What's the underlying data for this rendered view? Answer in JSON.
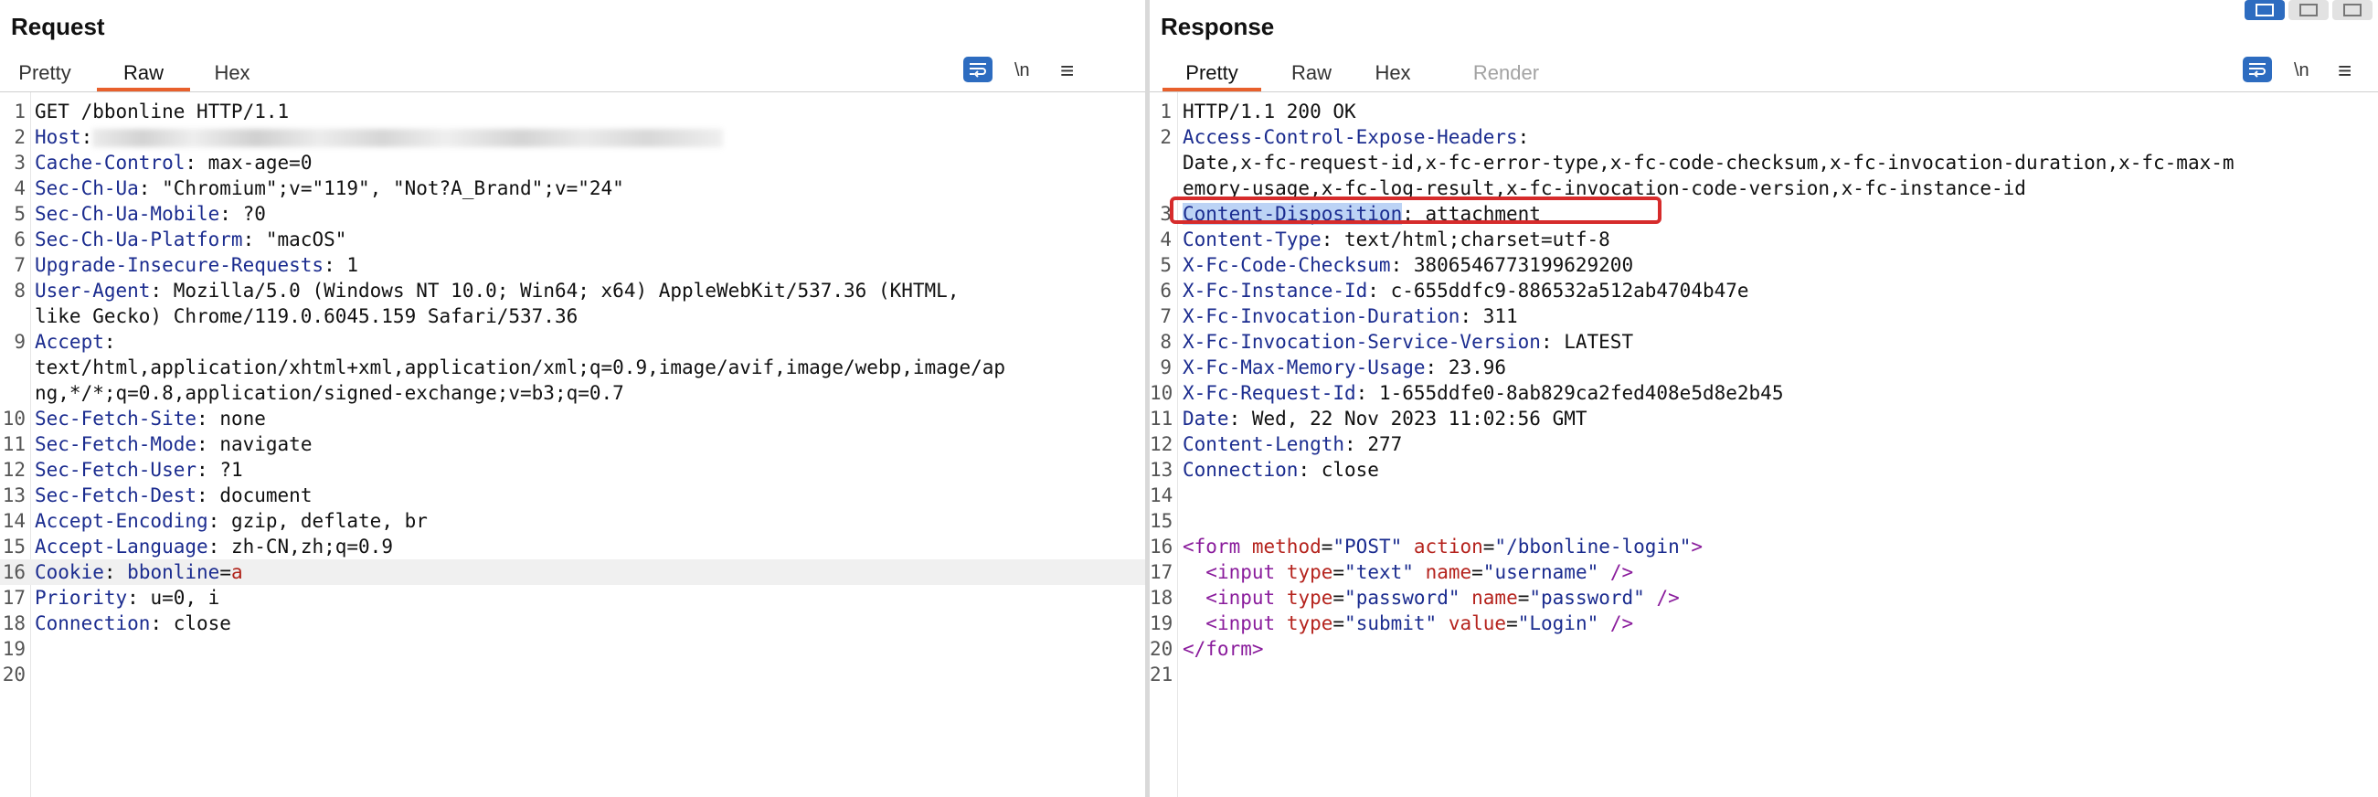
{
  "request": {
    "title": "Request",
    "tabs": [
      {
        "label": "Pretty",
        "state": "normal"
      },
      {
        "label": "Raw",
        "state": "active"
      },
      {
        "label": "Hex",
        "state": "normal"
      }
    ],
    "toolbar": {
      "wrap_icon": "wrap-lines-icon",
      "newline_label": "\\n",
      "menu_icon": "hamburger-menu-icon"
    },
    "lines": [
      {
        "n": "1",
        "plain": "GET /bbonline HTTP/1.1"
      },
      {
        "n": "2",
        "name": "Host",
        "value": "",
        "redacted": true
      },
      {
        "n": "3",
        "name": "Cache-Control",
        "value": " max-age=0"
      },
      {
        "n": "4",
        "name": "Sec-Ch-Ua",
        "value": " \"Chromium\";v=\"119\", \"Not?A_Brand\";v=\"24\""
      },
      {
        "n": "5",
        "name": "Sec-Ch-Ua-Mobile",
        "value": " ?0"
      },
      {
        "n": "6",
        "name": "Sec-Ch-Ua-Platform",
        "value": " \"macOS\""
      },
      {
        "n": "7",
        "name": "Upgrade-Insecure-Requests",
        "value": " 1"
      },
      {
        "n": "8",
        "name": "User-Agent",
        "value": " Mozilla/5.0 (Windows NT 10.0; Win64; x64) AppleWebKit/537.36 (KHTML,"
      },
      {
        "n": "",
        "plain": "like Gecko) Chrome/119.0.6045.159 Safari/537.36"
      },
      {
        "n": "9",
        "name": "Accept",
        "value": ""
      },
      {
        "n": "",
        "plain": "text/html,application/xhtml+xml,application/xml;q=0.9,image/avif,image/webp,image/ap"
      },
      {
        "n": "",
        "plain": "ng,*/*;q=0.8,application/signed-exchange;v=b3;q=0.7"
      },
      {
        "n": "10",
        "name": "Sec-Fetch-Site",
        "value": " none"
      },
      {
        "n": "11",
        "name": "Sec-Fetch-Mode",
        "value": " navigate"
      },
      {
        "n": "12",
        "name": "Sec-Fetch-User",
        "value": " ?1"
      },
      {
        "n": "13",
        "name": "Sec-Fetch-Dest",
        "value": " document"
      },
      {
        "n": "14",
        "name": "Accept-Encoding",
        "value": " gzip, deflate, br"
      },
      {
        "n": "15",
        "name": "Accept-Language",
        "value": " zh-CN,zh;q=0.9"
      },
      {
        "n": "16",
        "name": "Cookie",
        "value": " ",
        "cookie_name": "bbonline",
        "cookie_eq": "=",
        "cookie_val": "a",
        "current": true
      },
      {
        "n": "17",
        "name": "Priority",
        "value": " u=0, i"
      },
      {
        "n": "18",
        "name": "Connection",
        "value": " close"
      },
      {
        "n": "19",
        "plain": ""
      },
      {
        "n": "20",
        "plain": ""
      }
    ]
  },
  "response": {
    "title": "Response",
    "tabs": [
      {
        "label": "Pretty",
        "state": "active"
      },
      {
        "label": "Raw",
        "state": "normal"
      },
      {
        "label": "Hex",
        "state": "normal"
      },
      {
        "label": "Render",
        "state": "disabled"
      }
    ],
    "toolbar": {
      "wrap_icon": "wrap-lines-icon",
      "newline_label": "\\n",
      "menu_icon": "hamburger-menu-icon"
    },
    "layout_icons": [
      "split-columns-icon",
      "split-rows-icon",
      "single-panel-icon"
    ],
    "lines": [
      {
        "n": "1",
        "plain": "HTTP/1.1 200 OK"
      },
      {
        "n": "2",
        "name": "Access-Control-Expose-Headers",
        "value": ""
      },
      {
        "n": "",
        "plain": "Date,x-fc-request-id,x-fc-error-type,x-fc-code-checksum,x-fc-invocation-duration,x-fc-max-m"
      },
      {
        "n": "",
        "plain": "emory-usage,x-fc-log-result,x-fc-invocation-code-version,x-fc-instance-id"
      },
      {
        "n": "3",
        "name": "Content-Disposition",
        "value": " attachment",
        "selected": true
      },
      {
        "n": "4",
        "name": "Content-Type",
        "value": " text/html;charset=utf-8"
      },
      {
        "n": "5",
        "name": "X-Fc-Code-Checksum",
        "value": " 3806546773199629200"
      },
      {
        "n": "6",
        "name": "X-Fc-Instance-Id",
        "value": " c-655ddfc9-886532a512ab4704b47e"
      },
      {
        "n": "7",
        "name": "X-Fc-Invocation-Duration",
        "value": " 311"
      },
      {
        "n": "8",
        "name": "X-Fc-Invocation-Service-Version",
        "value": " LATEST"
      },
      {
        "n": "9",
        "name": "X-Fc-Max-Memory-Usage",
        "value": " 23.96"
      },
      {
        "n": "10",
        "name": "X-Fc-Request-Id",
        "value": " 1-655ddfe0-8ab829ca2fed408e5d8e2b45"
      },
      {
        "n": "11",
        "name": "Date",
        "value": " Wed, 22 Nov 2023 11:02:56 GMT"
      },
      {
        "n": "12",
        "name": "Content-Length",
        "value": " 277"
      },
      {
        "n": "13",
        "name": "Connection",
        "value": " close"
      },
      {
        "n": "14",
        "plain": ""
      },
      {
        "n": "15",
        "plain": ""
      },
      {
        "n": "16",
        "html": [
          [
            "t",
            "<form"
          ],
          [
            "p",
            " "
          ],
          [
            "a",
            "method"
          ],
          [
            "p",
            "="
          ],
          [
            "s",
            "\"POST\""
          ],
          [
            "p",
            " "
          ],
          [
            "a",
            "action"
          ],
          [
            "p",
            "="
          ],
          [
            "s",
            "\"/bbonline-login\""
          ],
          [
            "t",
            ">"
          ]
        ]
      },
      {
        "n": "17",
        "html": [
          [
            "p",
            "  "
          ],
          [
            "t",
            "<input"
          ],
          [
            "p",
            " "
          ],
          [
            "a",
            "type"
          ],
          [
            "p",
            "="
          ],
          [
            "s",
            "\"text\""
          ],
          [
            "p",
            " "
          ],
          [
            "a",
            "name"
          ],
          [
            "p",
            "="
          ],
          [
            "s",
            "\"username\""
          ],
          [
            "p",
            " "
          ],
          [
            "t",
            "/>"
          ]
        ]
      },
      {
        "n": "18",
        "html": [
          [
            "p",
            "  "
          ],
          [
            "t",
            "<input"
          ],
          [
            "p",
            " "
          ],
          [
            "a",
            "type"
          ],
          [
            "p",
            "="
          ],
          [
            "s",
            "\"password\""
          ],
          [
            "p",
            " "
          ],
          [
            "a",
            "name"
          ],
          [
            "p",
            "="
          ],
          [
            "s",
            "\"password\""
          ],
          [
            "p",
            " "
          ],
          [
            "t",
            "/>"
          ]
        ]
      },
      {
        "n": "19",
        "html": [
          [
            "p",
            "  "
          ],
          [
            "t",
            "<input"
          ],
          [
            "p",
            " "
          ],
          [
            "a",
            "type"
          ],
          [
            "p",
            "="
          ],
          [
            "s",
            "\"submit\""
          ],
          [
            "p",
            " "
          ],
          [
            "a",
            "value"
          ],
          [
            "p",
            "="
          ],
          [
            "s",
            "\"Login\""
          ],
          [
            "p",
            " "
          ],
          [
            "t",
            "/>"
          ]
        ]
      },
      {
        "n": "20",
        "html": [
          [
            "t",
            "</form>"
          ]
        ]
      },
      {
        "n": "21",
        "plain": ""
      }
    ]
  },
  "colors": {
    "accent_tab": "#e8602c",
    "header_name": "#1b2c8f",
    "html_tag": "#8a1c9c",
    "html_attr": "#b5231d",
    "highlight_box": "#d62b2b",
    "toolbar_blue": "#2d6cc0"
  }
}
